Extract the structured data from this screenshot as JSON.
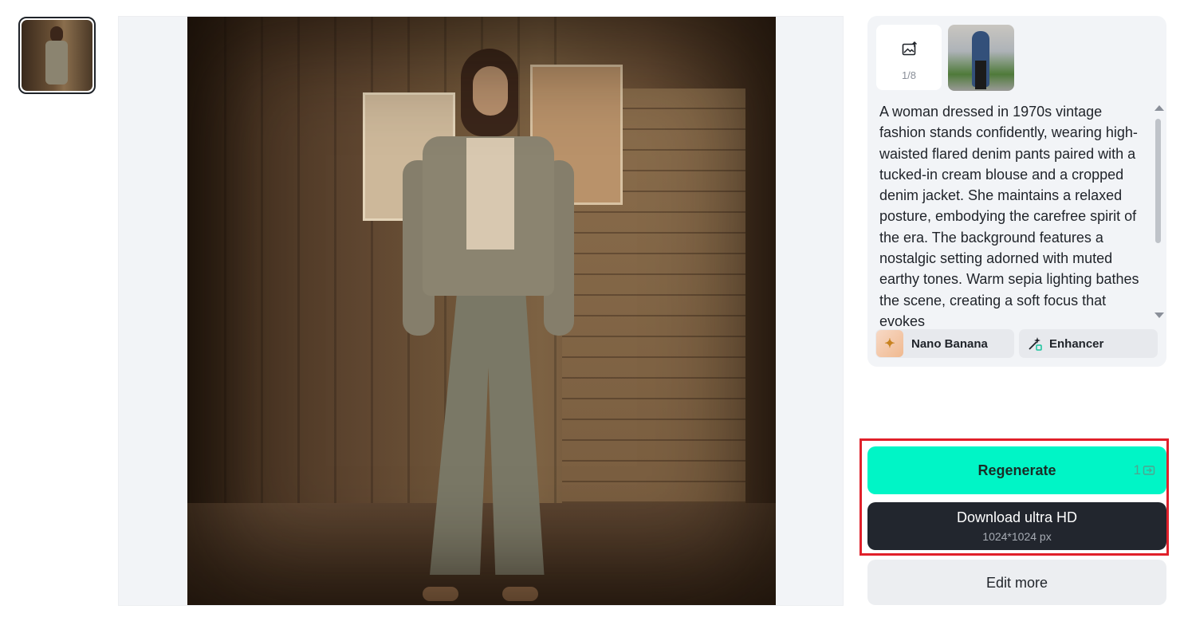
{
  "thumbnails": [
    {
      "id_label": "generated-image-1"
    }
  ],
  "reference": {
    "upload_count": "1/8"
  },
  "prompt": {
    "text": "A woman dressed in 1970s vintage fashion stands confidently, wearing high-waisted flared denim pants paired with a tucked-in cream blouse and a cropped denim jacket. She maintains a relaxed posture, embodying the carefree spirit of the era. The background features a nostalgic setting adorned with muted earthy tones. Warm sepia lighting bathes the scene, creating a soft focus that evokes"
  },
  "chips": {
    "model": "Nano Banana",
    "enhancer": "Enhancer"
  },
  "actions": {
    "regenerate_label": "Regenerate",
    "regenerate_cost": "1",
    "download_label": "Download ultra HD",
    "download_resolution": "1024*1024 px",
    "edit_label": "Edit more"
  },
  "colors": {
    "accent": "#00f5c6",
    "dark_button": "#22262e",
    "highlight": "#e0202a",
    "panel": "#f2f4f7"
  }
}
